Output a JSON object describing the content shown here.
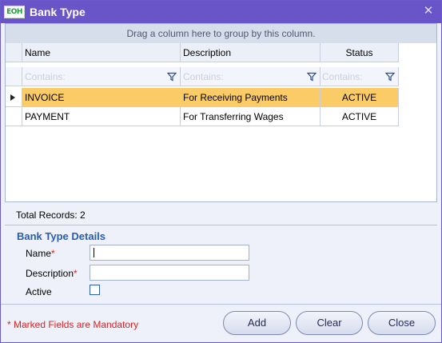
{
  "window": {
    "title": "Bank Type",
    "logo_text": "EOH",
    "close_glyph": "✕"
  },
  "grid": {
    "group_hint": "Drag a column here to group by this column.",
    "columns": [
      "Name",
      "Description",
      "Status"
    ],
    "filter_placeholder": "Contains:",
    "rows": [
      {
        "name": "INVOICE",
        "description": "For Receiving Payments",
        "status": "ACTIVE",
        "selected": true
      },
      {
        "name": "PAYMENT",
        "description": "For Transferring Wages",
        "status": "ACTIVE",
        "selected": false
      }
    ]
  },
  "total_records": "Total Records: 2",
  "details": {
    "title": "Bank Type Details",
    "name_label": "Name",
    "description_label": "Description",
    "active_label": "Active",
    "required_marker": "*",
    "name_value": "",
    "description_value": "",
    "active_checked": false
  },
  "footer": {
    "mandatory_note": "* Marked Fields are Mandatory",
    "add_label": "Add",
    "clear_label": "Clear",
    "close_label": "Close"
  },
  "colors": {
    "titlebar": "#6a55c8",
    "selected_row": "#fbcb67",
    "section_title": "#2a5db0",
    "required": "#e02020"
  },
  "icons": {
    "filter": "funnel-icon",
    "row_indicator": "arrow-right-icon",
    "close": "close-icon"
  }
}
